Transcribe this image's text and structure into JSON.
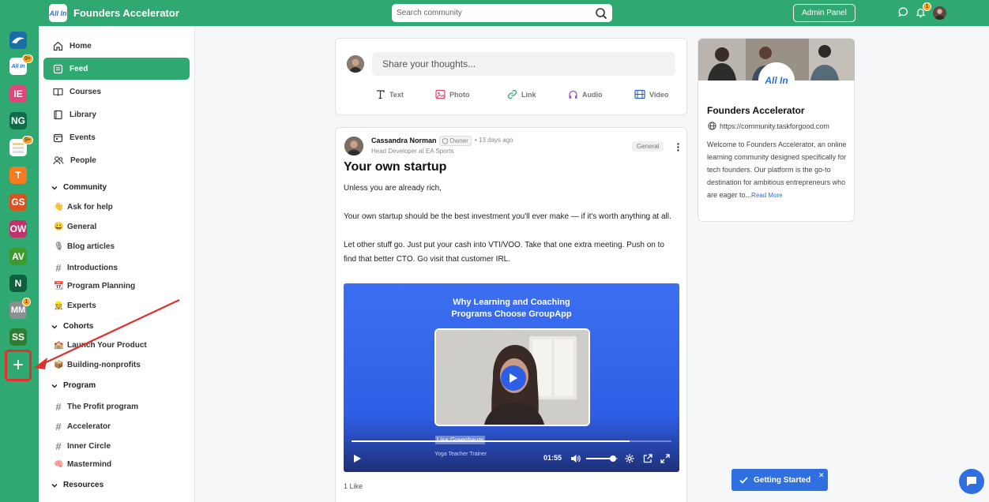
{
  "topbar": {
    "brand_logo_text": "All In",
    "brand": "Founders Accelerator",
    "search_placeholder": "Search community",
    "admin_label": "Admin Panel",
    "notifications_count": "1"
  },
  "rail": {
    "items": [
      {
        "label": "",
        "color": "#1a6ea5",
        "badge": ""
      },
      {
        "label": "All In",
        "color": "#ffffff",
        "badge": "9+"
      },
      {
        "label": "IE",
        "color": "#e0457b",
        "badge": ""
      },
      {
        "label": "NG",
        "color": "#0f6b4c",
        "badge": ""
      },
      {
        "label": "",
        "color": "#ffffff",
        "badge": "9+"
      },
      {
        "label": "T",
        "color": "#f47b20",
        "badge": ""
      },
      {
        "label": "GS",
        "color": "#d9541e",
        "badge": ""
      },
      {
        "label": "OW",
        "color": "#c4306d",
        "badge": ""
      },
      {
        "label": "AV",
        "color": "#3f9a2e",
        "badge": ""
      },
      {
        "label": "N",
        "color": "#0f5e3f",
        "badge": ""
      },
      {
        "label": "MM",
        "color": "#8a8f92",
        "badge": "1"
      },
      {
        "label": "SS",
        "color": "#2e7d32",
        "badge": ""
      }
    ],
    "add_symbol": "+"
  },
  "sidebar": {
    "main": [
      {
        "label": "Home",
        "icon": "home-icon"
      },
      {
        "label": "Feed",
        "icon": "feed-icon"
      },
      {
        "label": "Courses",
        "icon": "book-icon"
      },
      {
        "label": "Library",
        "icon": "library-icon"
      },
      {
        "label": "Events",
        "icon": "calendar-icon"
      },
      {
        "label": "People",
        "icon": "people-icon"
      }
    ],
    "sections": [
      {
        "title": "Community",
        "items": [
          {
            "emoji": "👋",
            "label": "Ask for help"
          },
          {
            "emoji": "😀",
            "label": "General"
          },
          {
            "emoji": "🎙",
            "label": "Blog articles"
          },
          {
            "emoji": "#",
            "label": "Introductions"
          },
          {
            "emoji": "📆",
            "label": "Program Planning"
          },
          {
            "emoji": "👷",
            "label": "Experts"
          }
        ]
      },
      {
        "title": "Cohorts",
        "items": [
          {
            "emoji": "🏫",
            "label": "Launch Your Product"
          },
          {
            "emoji": "📦",
            "label": "Building-nonprofits"
          }
        ]
      },
      {
        "title": "Program",
        "items": [
          {
            "emoji": "#",
            "label": "The Profit program"
          },
          {
            "emoji": "#",
            "label": "Accelerator"
          },
          {
            "emoji": "#",
            "label": "Inner Circle"
          },
          {
            "emoji": "🧠",
            "label": "Mastermind"
          }
        ]
      },
      {
        "title": "Resources",
        "items": []
      }
    ]
  },
  "composer": {
    "placeholder": "Share your thoughts...",
    "actions": [
      {
        "label": "Text",
        "icon": "text-icon"
      },
      {
        "label": "Photo",
        "icon": "photo-icon"
      },
      {
        "label": "Link",
        "icon": "link-icon"
      },
      {
        "label": "Audio",
        "icon": "audio-icon"
      },
      {
        "label": "Video",
        "icon": "video-icon"
      }
    ]
  },
  "post": {
    "author": "Cassandra Norman",
    "role_badge": "Owner",
    "time": "• 13 days ago",
    "subtitle": "Head Developer at EA Sports",
    "tag": "General",
    "title": "Your own startup",
    "paragraphs": [
      "Unless you are already rich,",
      "Your own startup should be the best investment you'll ever make — if it's worth anything at all.",
      "Let other stuff go. Just put your cash into VTI/VOO. Take that one extra meeting. Push on to find that better CTO. Go visit that customer IRL."
    ],
    "video": {
      "title_line1": "Why Learning and Coaching",
      "title_line2": "Programs Choose GroupApp",
      "person_name": "Lisa Greenbaum",
      "person_role": "Yoga Teacher Trainer",
      "time": "01:55",
      "progress": 0.87,
      "volume": 0.85
    },
    "likes": "1 Like"
  },
  "about": {
    "logo_text": "All In",
    "name": "Founders Accelerator",
    "url": "https://community.taskforgood.com",
    "description": "Welcome to Founders Accelerator, an online learning community designed specifically for tech founders. Our platform is the go-to destination for ambitious entrepreneurs who are eager to...",
    "read_more": "Read More"
  },
  "getting_started": {
    "label": "Getting Started",
    "close": "✕"
  },
  "colors": {
    "brand_green": "#2fa872",
    "accent_blue": "#2f6fe0",
    "annotation_red": "#e0322d"
  }
}
